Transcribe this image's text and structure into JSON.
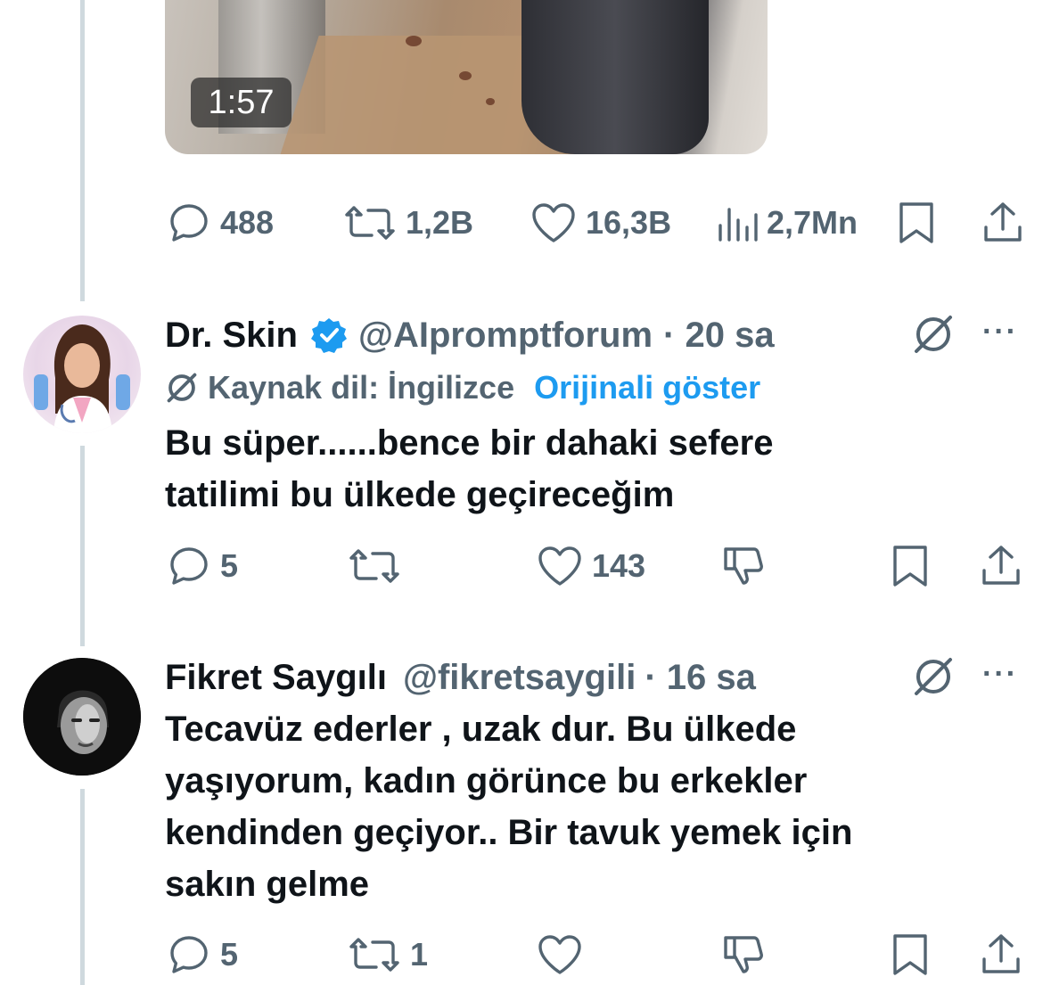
{
  "main_tweet": {
    "video_duration": "1:57",
    "replies": "488",
    "retweets": "1,2B",
    "likes": "16,3B",
    "views": "2,7Mn"
  },
  "reply1": {
    "name": "Dr. Skin",
    "handle": "@AIpromptforum",
    "time": "· 20 sa",
    "lang_label": "Kaynak dil: İngilizce",
    "show_original": "Orijinali göster",
    "text_lines": [
      "Bu süper......bence bir dahaki sefere",
      "tatilimi bu ülkede geçireceğim"
    ],
    "replies": "5",
    "likes": "143",
    "more": "···"
  },
  "reply2": {
    "name": "Fikret Saygılı",
    "handle": "@fikretsaygili",
    "time": "· 16 sa",
    "text_lines": [
      "Tecavüz ederler , uzak dur. Bu ülkede",
      "yaşıyorum, kadın görünce bu erkekler",
      "kendinden geçiyor.. Bir tavuk yemek için",
      "sakın gelme"
    ],
    "replies": "5",
    "retweets": "1",
    "more": "···"
  },
  "colors": {
    "verified": "#1d9bf0",
    "link": "#1d9bf0",
    "muted": "#536471",
    "text": "#0f1419"
  }
}
